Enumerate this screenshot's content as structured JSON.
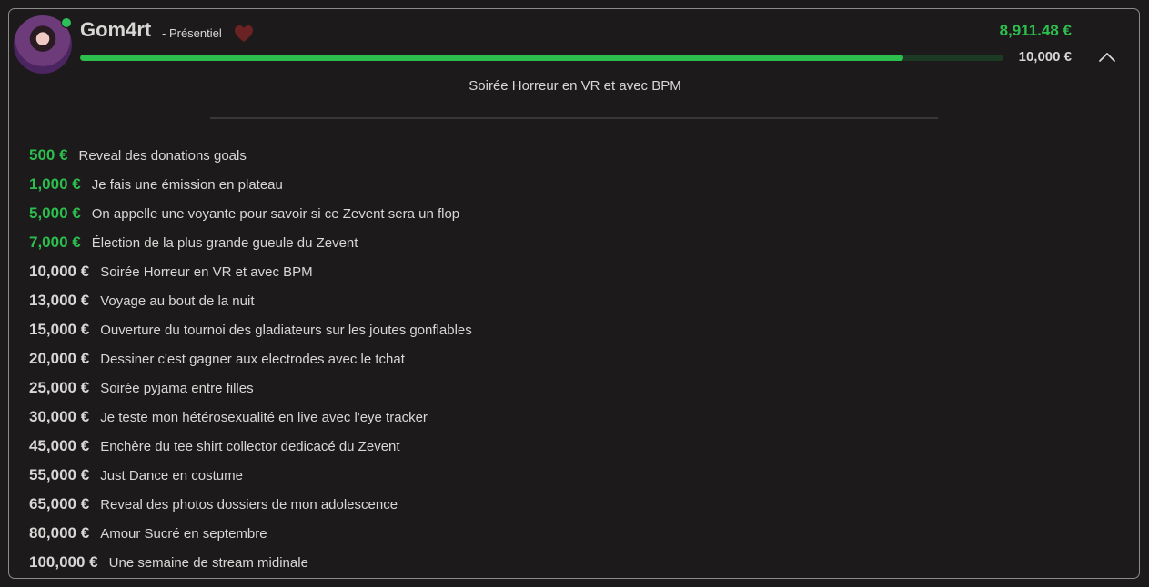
{
  "streamer": {
    "name": "Gom4rt",
    "mode": "- Présentiel",
    "online": true
  },
  "donations": {
    "raised": "8,911.48 €",
    "goal": "10,000 €",
    "progress_fraction": 0.891148,
    "current_goal_label": "Soirée Horreur en VR et avec BPM"
  },
  "colors": {
    "accent_green": "#2dbf4e",
    "text": "#d9d6d6",
    "background": "#1c1a1a",
    "heart": "#6b2222"
  },
  "icons": {
    "heart": "heart-icon",
    "collapse": "chevron-up-icon",
    "online": "online-dot"
  },
  "goals": [
    {
      "amount": "500 €",
      "label": "Reveal des donations goals",
      "reached": true
    },
    {
      "amount": "1,000 €",
      "label": "Je fais une émission en plateau",
      "reached": true
    },
    {
      "amount": "5,000 €",
      "label": "On appelle une voyante pour savoir si ce Zevent sera un flop",
      "reached": true
    },
    {
      "amount": "7,000 €",
      "label": "Élection de la plus grande gueule du Zevent",
      "reached": true
    },
    {
      "amount": "10,000 €",
      "label": "Soirée Horreur en VR et avec BPM",
      "reached": false
    },
    {
      "amount": "13,000 €",
      "label": "Voyage au bout de la nuit",
      "reached": false
    },
    {
      "amount": "15,000 €",
      "label": "Ouverture du tournoi des gladiateurs sur les joutes gonflables",
      "reached": false
    },
    {
      "amount": "20,000 €",
      "label": "Dessiner c'est gagner aux electrodes avec le tchat",
      "reached": false
    },
    {
      "amount": "25,000 €",
      "label": "Soirée pyjama entre filles",
      "reached": false
    },
    {
      "amount": "30,000 €",
      "label": "Je teste mon hétérosexualité en live avec l'eye tracker",
      "reached": false
    },
    {
      "amount": "45,000 €",
      "label": "Enchère du tee shirt collector dedicacé du Zevent",
      "reached": false
    },
    {
      "amount": "55,000 €",
      "label": "Just Dance en costume",
      "reached": false
    },
    {
      "amount": "65,000 €",
      "label": "Reveal des photos dossiers de mon adolescence",
      "reached": false
    },
    {
      "amount": "80,000 €",
      "label": "Amour Sucré en septembre",
      "reached": false
    },
    {
      "amount": "100,000 €",
      "label": "Une semaine de stream midinale",
      "reached": false
    }
  ]
}
